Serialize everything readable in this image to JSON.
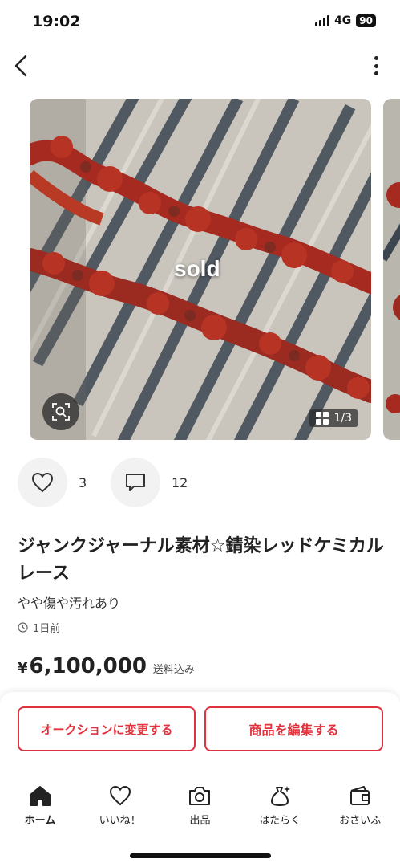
{
  "status_bar": {
    "time": "19:02",
    "network": "4G",
    "battery": "90"
  },
  "product": {
    "sold_label": "sold",
    "image_counter": "1/3",
    "likes_count": "3",
    "comments_count": "12",
    "title": "ジャンクジャーナル素材☆錆染レッドケミカルレース",
    "condition": "やや傷や汚れあり",
    "posted": "1日前",
    "price_symbol": "¥",
    "price": "6,100,000",
    "shipping": "送料込み"
  },
  "actions": {
    "auction_label": "オークションに変更する",
    "edit_label": "商品を編集する"
  },
  "tabs": [
    {
      "label": "ホーム",
      "icon": "home-icon",
      "active": true
    },
    {
      "label": "いいね！",
      "icon": "heart-icon",
      "active": false
    },
    {
      "label": "出品",
      "icon": "camera-icon",
      "active": false
    },
    {
      "label": "はたらく",
      "icon": "money-bag-icon",
      "active": false
    },
    {
      "label": "おさいふ",
      "icon": "wallet-icon",
      "active": false
    }
  ],
  "colors": {
    "accent": "#e0313c",
    "text": "#222222"
  }
}
